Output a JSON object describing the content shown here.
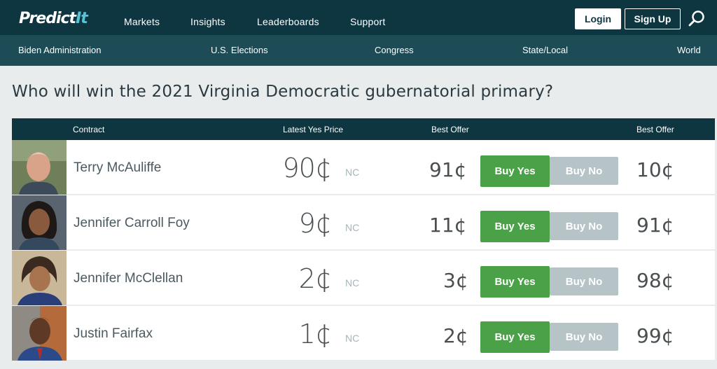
{
  "header": {
    "logo_main": "Predict",
    "logo_accent": "It",
    "nav": [
      "Markets",
      "Insights",
      "Leaderboards",
      "Support"
    ],
    "login": "Login",
    "signup": "Sign Up"
  },
  "subnav": [
    "Biden Administration",
    "U.S. Elections",
    "Congress",
    "State/Local",
    "World"
  ],
  "page": {
    "title": "Who will win the 2021 Virginia Democratic gubernatorial primary?"
  },
  "table": {
    "headers": {
      "contract": "Contract",
      "latest_yes_price": "Latest Yes Price",
      "best_offer_yes": "Best Offer",
      "best_offer_no": "Best Offer"
    },
    "rows": [
      {
        "name": "Terry McAuliffe",
        "latest": "90¢",
        "change": "NC",
        "best_yes": "91¢",
        "buy_yes": "Buy Yes",
        "buy_no": "Buy No",
        "best_no": "10¢"
      },
      {
        "name": "Jennifer Carroll Foy",
        "latest": "9¢",
        "change": "NC",
        "best_yes": "11¢",
        "buy_yes": "Buy Yes",
        "buy_no": "Buy No",
        "best_no": "91¢"
      },
      {
        "name": "Jennifer McClellan",
        "latest": "2¢",
        "change": "NC",
        "best_yes": "3¢",
        "buy_yes": "Buy Yes",
        "buy_no": "Buy No",
        "best_no": "98¢"
      },
      {
        "name": "Justin Fairfax",
        "latest": "1¢",
        "change": "NC",
        "best_yes": "2¢",
        "buy_yes": "Buy Yes",
        "buy_no": "Buy No",
        "best_no": "99¢"
      }
    ]
  },
  "colors": {
    "header_bg": "#0e3641",
    "subnav_bg": "#1d4b56",
    "buy_yes": "#4aa147",
    "buy_no": "#b7c4c7"
  }
}
